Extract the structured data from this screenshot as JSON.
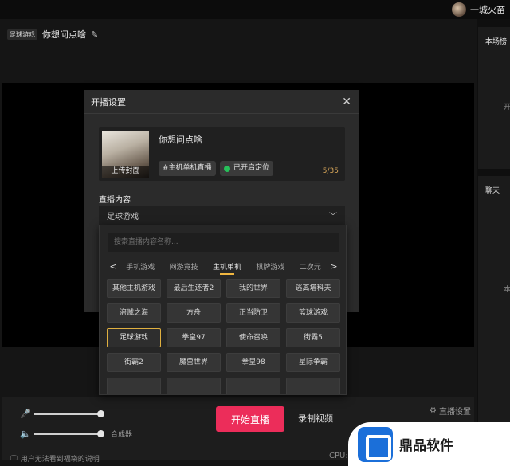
{
  "user": {
    "name": "一城火苗"
  },
  "stream": {
    "category_badge": "足球游戏",
    "title": "你想问点啥"
  },
  "dialog": {
    "title": "开播设置",
    "cover_caption": "上传封面",
    "stream_title": "你想问点啥",
    "tag": "#主机单机直播",
    "location": "已开启定位",
    "counter": "5/35",
    "content_label": "直播内容",
    "content_value": "足球游戏"
  },
  "dropdown": {
    "search_placeholder": "搜索直播内容名称...",
    "categories": [
      "手机游戏",
      "网游竞技",
      "主机单机",
      "棋牌游戏",
      "二次元"
    ],
    "active_category": "主机单机",
    "games": [
      "其他主机游戏",
      "最后生还者2",
      "我的世界",
      "逃离塔科夫",
      "盗贼之海",
      "方舟",
      "正当防卫",
      "篮球游戏",
      "足球游戏",
      "拳皇97",
      "使命召唤",
      "街霸5",
      "街霸2",
      "魔兽世界",
      "拳皇98",
      "星际争霸",
      "",
      "",
      "",
      ""
    ],
    "selected_game": "足球游戏"
  },
  "bottombar": {
    "synth_label": "合成器",
    "start_button": "开始直播",
    "record_button": "录制视频",
    "live_settings": "直播设置",
    "mic_level": 1.0,
    "speaker_level": 1.0
  },
  "footer": {
    "note": "用户无法看到福袋的说明",
    "cpu": "CPU:"
  },
  "right_panel": {
    "rank_title": "本场榜",
    "rank_sub": "开",
    "chat_title": "聊天",
    "chat_sub": "本"
  },
  "watermark": {
    "text": "鼎品软件"
  },
  "colors": {
    "accent": "#ec2d5a",
    "selected_border": "#e0b040",
    "location": "#27c05a"
  }
}
